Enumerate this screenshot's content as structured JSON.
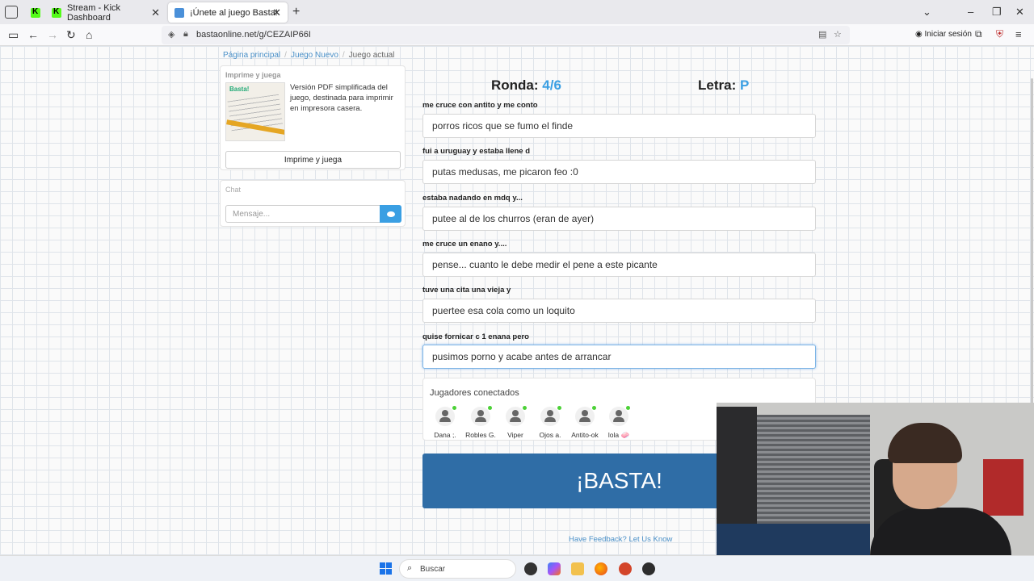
{
  "browser": {
    "tabs": [
      {
        "label": "",
        "icon": "kick-favicon"
      },
      {
        "label": "Stream - Kick Dashboard",
        "icon": "kick-favicon"
      },
      {
        "label": "¡Únete al juego Basta!",
        "icon": "basta-favicon",
        "active": true
      }
    ],
    "url": "bastaonline.net/g/CEZAIP66I",
    "signin_label": "Iniciar sesión"
  },
  "breadcrumb": {
    "home": "Página principal",
    "new_game": "Juego Nuevo",
    "current": "Juego actual"
  },
  "print_panel": {
    "title": "Imprime y juega",
    "logo_text": "Basta!",
    "description": "Versión PDF simplificada del juego, destinada para imprimir en impresora casera.",
    "button_label": "Imprime y juega"
  },
  "chat": {
    "title": "Chat",
    "placeholder": "Mensaje..."
  },
  "game": {
    "round_label": "Ronda:",
    "round_value": "4/6",
    "letter_label": "Letra:",
    "letter_value": "P",
    "accent_color": "#3a9fe3",
    "questions": [
      {
        "prompt": "me cruce con antito y me conto",
        "answer": "porros ricos que se fumo el finde"
      },
      {
        "prompt": "fui a uruguay y estaba llene d",
        "answer": "putas medusas, me picaron feo :0"
      },
      {
        "prompt": "estaba nadando en mdq y...",
        "answer": "putee al de los churros (eran de ayer)"
      },
      {
        "prompt": "me cruce un enano y....",
        "answer": "pense... cuanto le debe medir el pene a este picante"
      },
      {
        "prompt": "tuve una cita una vieja y",
        "answer": "puertee esa cola como un loquito"
      },
      {
        "prompt": "quise fornicar c 1 enana pero",
        "answer": "pusimos porno y acabe antes de arrancar"
      }
    ]
  },
  "players": {
    "title": "Jugadores conectados",
    "list": [
      "Dana ;.",
      "Robles G.",
      "Viper",
      "Ojos a.",
      "Antito-ok",
      "lola 🧼"
    ]
  },
  "basta_button": {
    "label": "¡BASTA!",
    "color": "#2f6da6"
  },
  "feedback_link": "Have Feedback? Let Us Know",
  "taskbar": {
    "search_placeholder": "Buscar"
  }
}
